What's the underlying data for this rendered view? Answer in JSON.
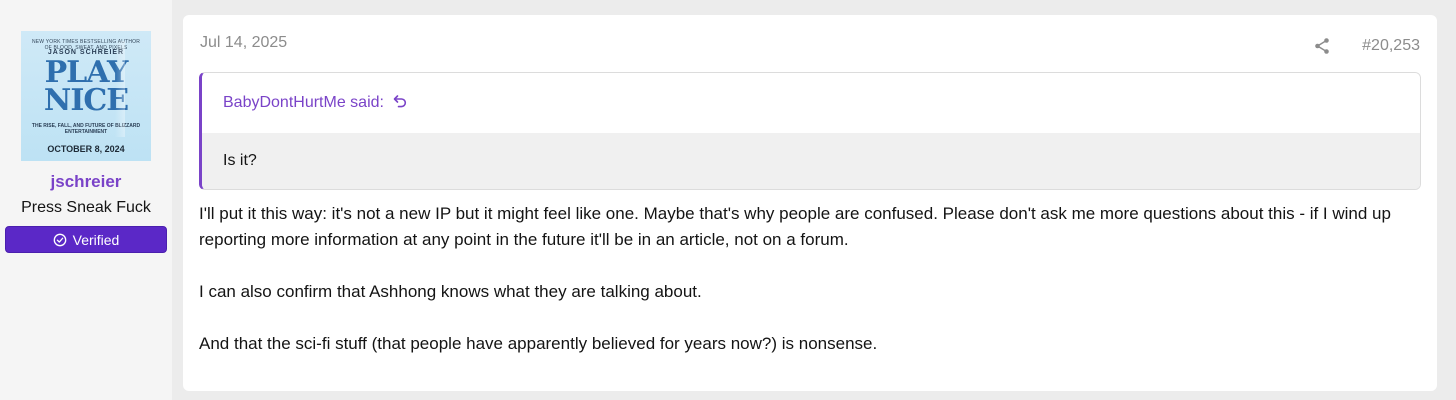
{
  "user": {
    "avatar": {
      "top_text": "NEW YORK TIMES BESTSELLING AUTHOR OF BLOOD, SWEAT, AND PIXELS",
      "author": "JASON SCHREIER",
      "title_line1": "PLAY",
      "title_line2": "NICE",
      "subtitle": "THE RISE, FALL, AND FUTURE OF BLIZZARD ENTERTAINMENT",
      "date": "OCTOBER 8, 2024"
    },
    "username": "jschreier",
    "title": "Press Sneak Fuck",
    "badge": "Verified"
  },
  "post": {
    "date": "Jul 14, 2025",
    "number": "#20,253",
    "quote": {
      "author_said": "BabyDontHurtMe said:",
      "text": "Is it?"
    },
    "paragraphs": [
      "I'll put it this way: it's not a new IP but it might feel like one. Maybe that's why people are confused. Please don't ask me more questions about this - if I wind up reporting more information at any point in the future it'll be in an article, not on a forum.",
      "I can also confirm that Ashhong knows what they are talking about.",
      "And that the sci-fi stuff (that people have apparently believed for years now?) is nonsense."
    ]
  },
  "icons": {
    "share": "share-icon",
    "quote_jump": "undo-arrow-icon",
    "verified": "check-circle-icon"
  },
  "colors": {
    "accent": "#7a43c8",
    "badge": "#5b28c7"
  }
}
